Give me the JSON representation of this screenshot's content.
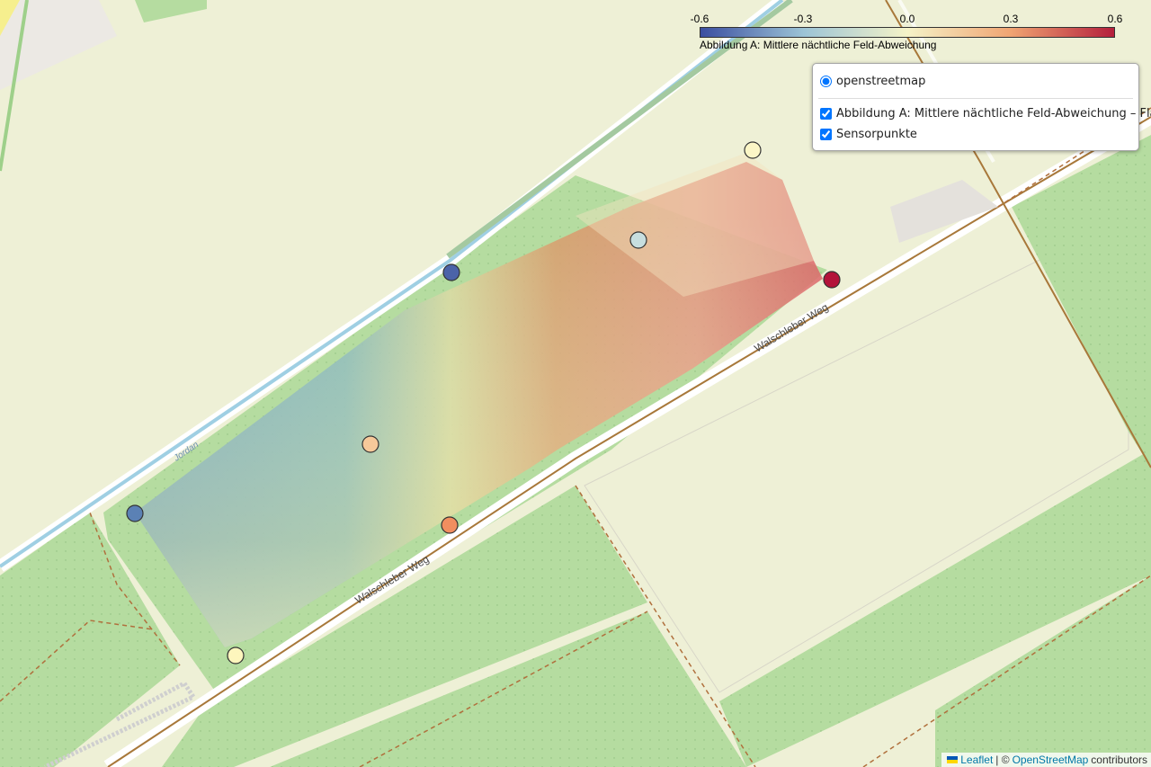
{
  "basemap": {
    "roads": [
      {
        "name": "Walschleber Weg"
      },
      {
        "name": "Jordan"
      }
    ]
  },
  "legend": {
    "ticks": [
      "-0.6",
      "-0.3",
      "0.0",
      "0.3",
      "0.6"
    ],
    "caption": "Abbildung A: Mittlere nächtliche Feld-Abweichung",
    "colors": [
      "#3b4ea0",
      "#9cc4d6",
      "#f5f3c8",
      "#f0a472",
      "#b41f3c"
    ]
  },
  "layer_control": {
    "base": {
      "label": "openstreetmap",
      "checked": true
    },
    "overlays": [
      {
        "label": "Abbildung A: Mittlere nächtliche Feld-Abweichung – Fläche",
        "checked": true
      },
      {
        "label": "Sensorpunkte",
        "checked": true
      }
    ]
  },
  "sensors": [
    {
      "value": 0.05,
      "color": "#fbf6c6"
    },
    {
      "value": -0.1,
      "color": "#c7dedf"
    },
    {
      "value": -0.5,
      "color": "#4b63a8"
    },
    {
      "value": 0.6,
      "color": "#b3133a"
    },
    {
      "value": 0.2,
      "color": "#f7c99a"
    },
    {
      "value": -0.45,
      "color": "#5b81b5"
    },
    {
      "value": 0.35,
      "color": "#f28e5f"
    },
    {
      "value": 0.05,
      "color": "#fdf6bd"
    }
  ],
  "attribution": {
    "leaflet": "Leaflet",
    "sep": "| ©",
    "osm": "OpenStreetMap",
    "contributors": "contributors"
  }
}
